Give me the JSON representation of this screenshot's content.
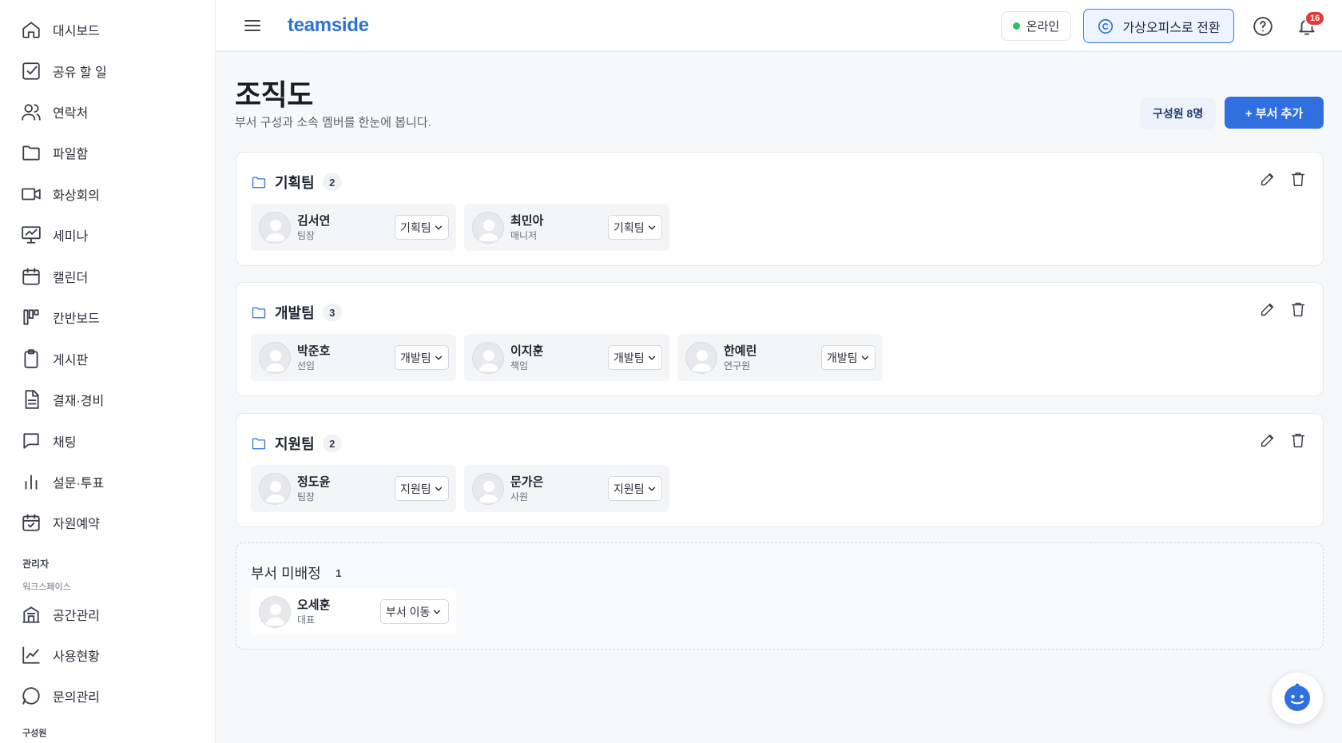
{
  "sidebar": {
    "items": [
      {
        "label": "대시보드",
        "icon": "home-icon"
      },
      {
        "label": "공유 할 일",
        "icon": "checkbox-icon"
      },
      {
        "label": "연락처",
        "icon": "users-icon"
      },
      {
        "label": "파일함",
        "icon": "folder-icon"
      },
      {
        "label": "화상회의",
        "icon": "video-icon"
      },
      {
        "label": "세미나",
        "icon": "presentation-icon"
      },
      {
        "label": "캘린더",
        "icon": "calendar-icon"
      },
      {
        "label": "칸반보드",
        "icon": "kanban-icon"
      },
      {
        "label": "게시판",
        "icon": "clipboard-icon"
      },
      {
        "label": "결재·경비",
        "icon": "document-icon"
      },
      {
        "label": "채팅",
        "icon": "chat-icon"
      },
      {
        "label": "설문·투표",
        "icon": "bar-chart-icon"
      },
      {
        "label": "자원예약",
        "icon": "calendar-check-icon"
      }
    ],
    "admin_label": "관리자",
    "workspace_label": "워크스페이스",
    "admin_items": [
      {
        "label": "공간관리",
        "icon": "building-icon"
      },
      {
        "label": "사용현황",
        "icon": "line-chart-icon"
      },
      {
        "label": "문의관리",
        "icon": "message-circle-icon"
      }
    ],
    "members_label": "구성원"
  },
  "header": {
    "brand": "teamside",
    "status": "온라인",
    "status_color": "#22c55e",
    "switch_label": "가상오피스로 전환",
    "notification_count": "16"
  },
  "page": {
    "title": "조직도",
    "subtitle": "부서 구성과 소속 멤버를 한눈에 봅니다.",
    "member_count": "구성원 8명",
    "add_dept_label": "+ 부서 추가"
  },
  "departments": [
    {
      "name": "기획팀",
      "count": "2",
      "members": [
        {
          "name": "김서연",
          "role": "팀장",
          "dept": "기획팀"
        },
        {
          "name": "최민아",
          "role": "매니저",
          "dept": "기획팀"
        }
      ]
    },
    {
      "name": "개발팀",
      "count": "3",
      "members": [
        {
          "name": "박준호",
          "role": "선임",
          "dept": "개발팀"
        },
        {
          "name": "이지훈",
          "role": "책임",
          "dept": "개발팀"
        },
        {
          "name": "한예린",
          "role": "연구원",
          "dept": "개발팀"
        }
      ]
    },
    {
      "name": "지원팀",
      "count": "2",
      "members": [
        {
          "name": "정도윤",
          "role": "팀장",
          "dept": "지원팀"
        },
        {
          "name": "문가은",
          "role": "사원",
          "dept": "지원팀"
        }
      ]
    }
  ],
  "unassigned": {
    "name": "부서 미배정",
    "count": "1",
    "members": [
      {
        "name": "오세훈",
        "role": "대표",
        "dept": "부서 이동"
      }
    ]
  },
  "colors": {
    "accent": "#2f6fe0",
    "brand": "#2f6fd8",
    "badge": "#e53935"
  }
}
